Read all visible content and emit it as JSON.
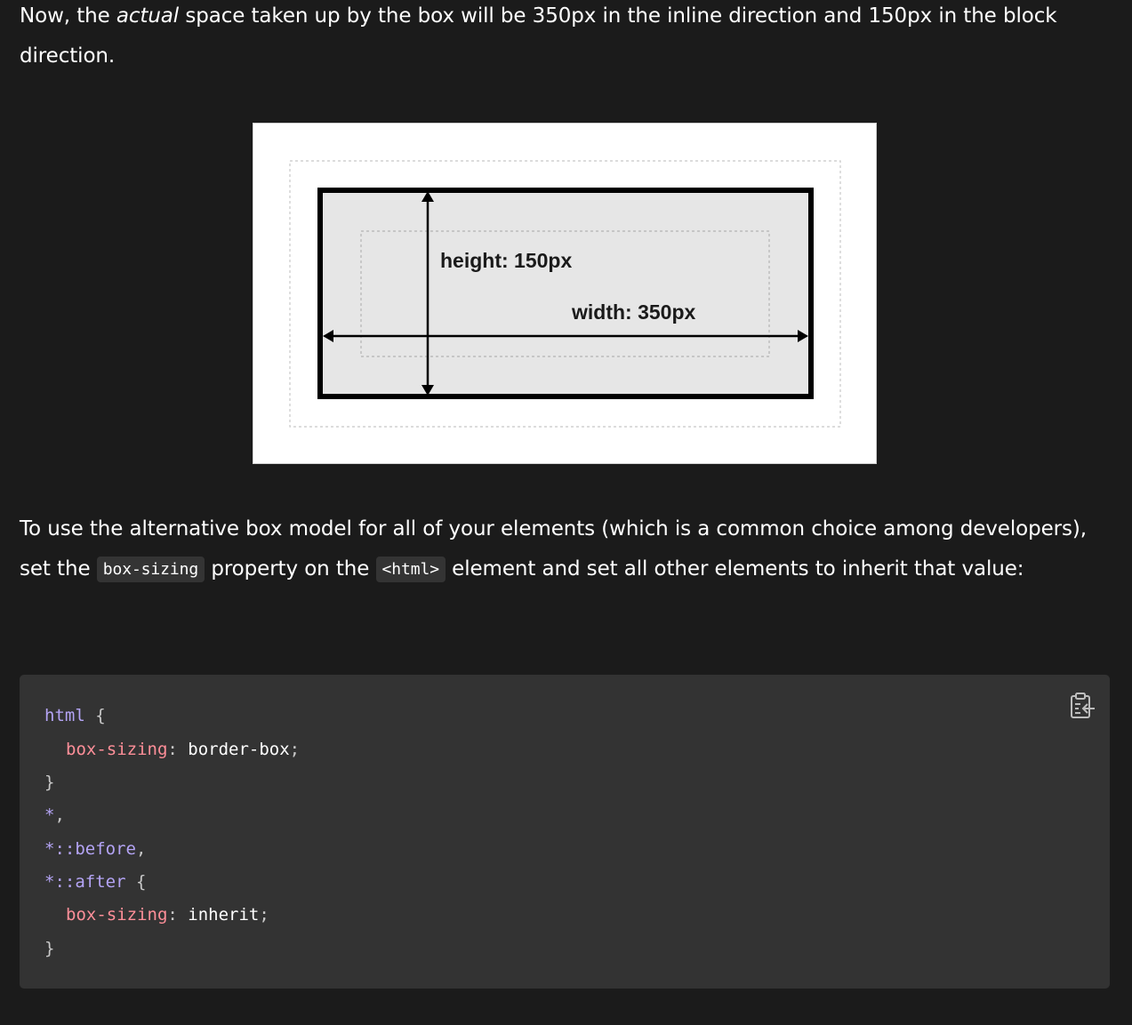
{
  "intro": {
    "text_before": "Now, the ",
    "text_em": "actual",
    "text_after": " space taken up by the box will be 350px in the inline direction and 150px in the block direction."
  },
  "diagram": {
    "height_label": "height: 150px",
    "width_label": "width: 350px"
  },
  "instruction": {
    "part1": "To use the alternative box model for all of your elements (which is a common choice among developers), set the ",
    "code1": "box-sizing",
    "part2": " property on the ",
    "code2": "<html>",
    "part3": " element and set all other elements to inherit that value:"
  },
  "code": {
    "l1_sel": "html",
    "l1_brace": " {",
    "l2_prop": "box-sizing",
    "l2_colon": ": ",
    "l2_val": "border-box",
    "l2_semi": ";",
    "l3": "}",
    "l4_sel": "*",
    "l4_punc": ",",
    "l5_sel": "*::before",
    "l5_punc": ",",
    "l6_sel": "*::after",
    "l6_brace": " {",
    "l7_prop": "box-sizing",
    "l7_colon": ": ",
    "l7_val": "inherit",
    "l7_semi": ";",
    "l8": "}"
  },
  "copy_button": {
    "icon": "clipboard-copy-icon"
  }
}
